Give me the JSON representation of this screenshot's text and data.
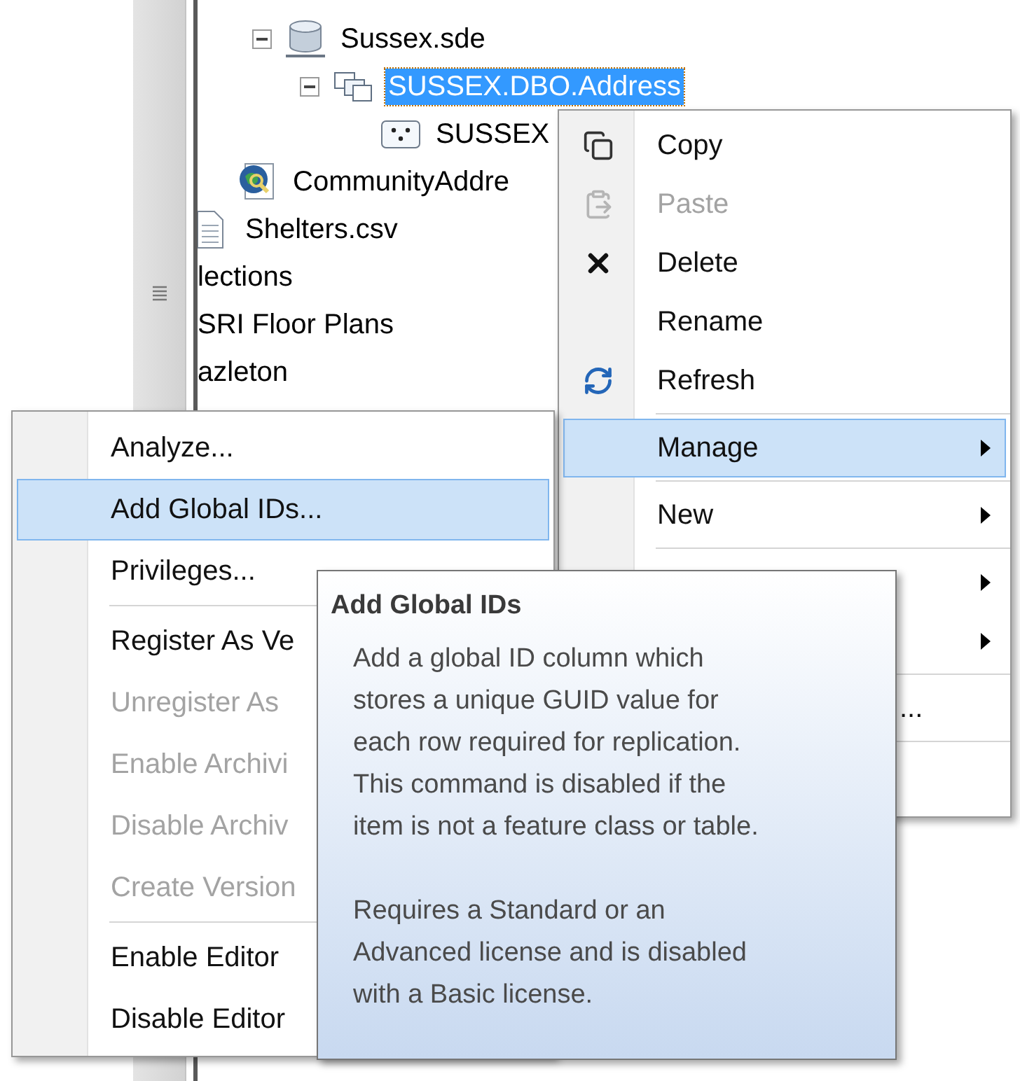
{
  "tree": {
    "items": [
      {
        "children": [
          {
            "children": [
              {
                "children": [
                  {
                    "label": "Sussex.sde",
                    "kind": "database",
                    "selected": false,
                    "expanded": true,
                    "children": [
                      {
                        "label": "SUSSEX.DBO.Address",
                        "kind": "dataset",
                        "selected": true,
                        "expanded": true,
                        "children": [
                          {
                            "label": "SUSSEX",
                            "kind": "points",
                            "selected": false
                          }
                        ]
                      }
                    ]
                  }
                ]
              },
              {
                "label": "CommunityAddre",
                "kind": "map",
                "selected": false
              }
            ]
          },
          {
            "label": "Shelters.csv",
            "kind": "file",
            "selected": false
          }
        ]
      },
      {
        "label": "lections",
        "selected": false
      },
      {
        "label": "SRI Floor Plans",
        "selected": false
      },
      {
        "label": "azleton",
        "selected": false
      }
    ]
  },
  "context_menu": {
    "items": [
      {
        "kind": "item",
        "label": "Copy",
        "disabled": false,
        "selected": false
      },
      {
        "kind": "item",
        "label": "Paste",
        "disabled": true,
        "selected": false
      },
      {
        "kind": "item",
        "label": "Delete",
        "disabled": false,
        "selected": false
      },
      {
        "kind": "item",
        "label": "Rename",
        "disabled": false,
        "selected": false
      },
      {
        "kind": "item",
        "label": "Refresh",
        "disabled": false,
        "selected": false
      },
      {
        "kind": "separator"
      },
      {
        "kind": "submenu",
        "label": "Manage",
        "disabled": false,
        "selected": true
      },
      {
        "kind": "separator"
      },
      {
        "kind": "submenu",
        "label": "New",
        "disabled": false,
        "selected": false
      },
      {
        "kind": "separator"
      },
      {
        "kind": "submenu",
        "selected": false
      },
      {
        "kind": "submenu",
        "selected": false
      },
      {
        "kind": "separator"
      },
      {
        "kind": "tail",
        "label": "...",
        "disabled": false,
        "selected": false
      },
      {
        "kind": "separator"
      }
    ]
  },
  "manage_menu": {
    "items": [
      {
        "kind": "item",
        "label": "Analyze...",
        "disabled": false,
        "selected": false
      },
      {
        "kind": "item",
        "label": "Add Global IDs...",
        "disabled": false,
        "selected": true
      },
      {
        "kind": "item",
        "label": "Privileges...",
        "disabled": false,
        "selected": false
      },
      {
        "kind": "separator"
      },
      {
        "kind": "item",
        "label": "Register As Ve",
        "disabled": false,
        "selected": false
      },
      {
        "kind": "item",
        "label": "Unregister As",
        "disabled": true,
        "selected": false
      },
      {
        "kind": "item",
        "label": "Enable Archivi",
        "disabled": true,
        "selected": false
      },
      {
        "kind": "item",
        "label": "Disable Archiv",
        "disabled": true,
        "selected": false
      },
      {
        "kind": "item",
        "label": "Create Version",
        "disabled": true,
        "selected": false
      },
      {
        "kind": "separator"
      },
      {
        "kind": "item",
        "label": "Enable Editor",
        "disabled": false,
        "selected": false
      },
      {
        "kind": "item",
        "label": "Disable Editor",
        "disabled": false,
        "selected": false
      }
    ]
  },
  "tooltip": {
    "title": "Add Global IDs",
    "paragraphs": [
      "Add a global ID column which stores a unique GUID value for each row required for replication. This command is disabled if the item is not a feature class or table.",
      "Requires a Standard or an Advanced license and is disabled with a Basic license."
    ]
  }
}
